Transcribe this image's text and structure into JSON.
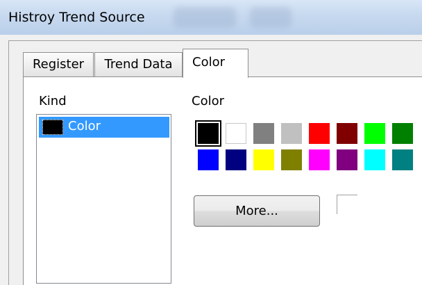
{
  "window": {
    "title": "Histroy Trend Source"
  },
  "tabs": [
    {
      "label": "Register",
      "active": false
    },
    {
      "label": "Trend Data",
      "active": false
    },
    {
      "label": "Color",
      "active": true
    }
  ],
  "kind": {
    "label": "Kind",
    "items": [
      {
        "label": "Color",
        "swatch_color": "#000000",
        "selected": true
      }
    ]
  },
  "color_panel": {
    "label": "Color",
    "selected_index": 0,
    "palette": [
      "#000000",
      "#ffffff",
      "#808080",
      "#c0c0c0",
      "#ff0000",
      "#800000",
      "#00ff00",
      "#008000",
      "#0000ff",
      "#000080",
      "#ffff00",
      "#808000",
      "#ff00ff",
      "#800080",
      "#00ffff",
      "#008080"
    ],
    "more_button_label": "More..."
  },
  "colors": {
    "titlebar": "#c7d9ef",
    "selection": "#3399ff",
    "dialog_bg": "#f0f0f0"
  }
}
